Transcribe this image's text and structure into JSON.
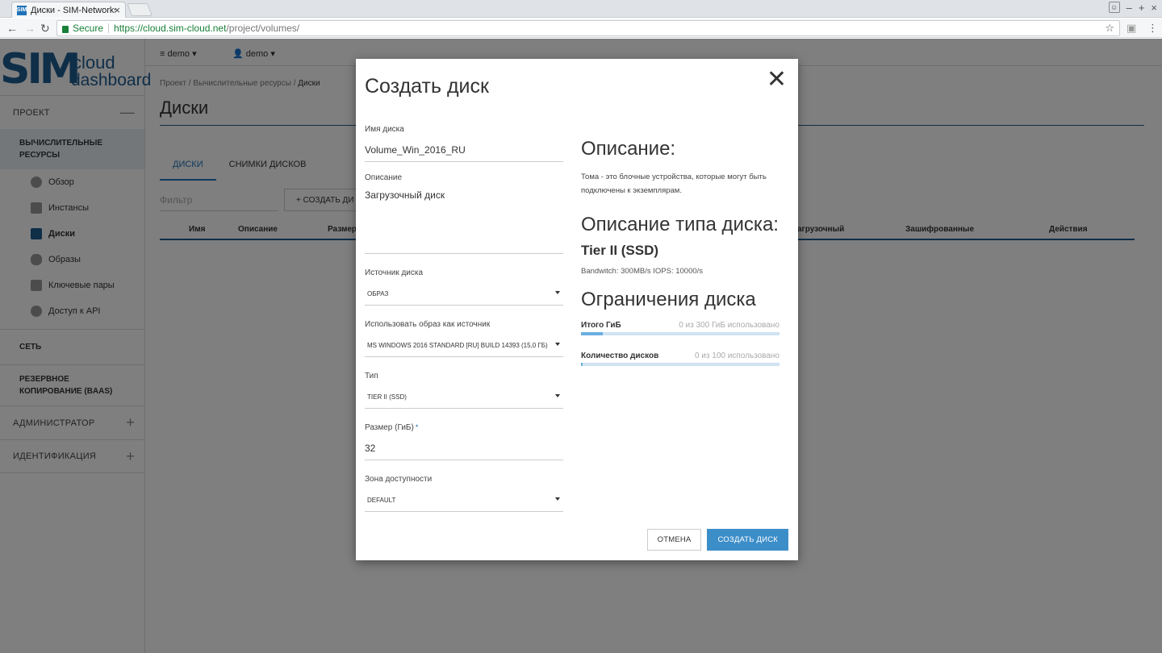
{
  "browser": {
    "tab_title": "Диски - SIM-Networks",
    "tab_favicon": "SIM",
    "secure_label": "Secure",
    "url_host": "https://cloud.sim-cloud.net",
    "url_path": "/project/volumes/"
  },
  "logo": {
    "sim": "SIM",
    "cloud": "cloud",
    "dashboard": "dashboard"
  },
  "topnav": {
    "project": "demo",
    "user": "demo"
  },
  "sidebar": {
    "project": "ПРОЕКТ",
    "compute": "ВЫЧИСЛИТЕЛЬНЫЕ РЕСУРСЫ",
    "items": [
      {
        "label": "Обзор"
      },
      {
        "label": "Инстансы"
      },
      {
        "label": "Диски"
      },
      {
        "label": "Образы"
      },
      {
        "label": "Ключевые пары"
      },
      {
        "label": "Доступ к API"
      }
    ],
    "network": "СЕТЬ",
    "backup": "РЕЗЕРВНОЕ КОПИРОВАНИЕ (BAAS)",
    "admin": "АДМИНИСТРАТОР",
    "identity": "ИДЕНТИФИКАЦИЯ"
  },
  "main": {
    "breadcrumb": [
      "Проект",
      "Вычислительные ресурсы",
      "Диски"
    ],
    "title": "Диски",
    "tabs": [
      "ДИСКИ",
      "СНИМКИ ДИСКОВ"
    ],
    "filter_placeholder": "Фильтр",
    "create_button": "+ СОЗДАТЬ ДИ",
    "columns": [
      "Имя",
      "Описание",
      "Размер",
      "агрузочный",
      "Зашифрованные",
      "Действия"
    ]
  },
  "modal": {
    "title": "Создать диск",
    "name_label": "Имя диска",
    "name_value": "Volume_Win_2016_RU",
    "desc_label": "Описание",
    "desc_value": "Загрузочный диск",
    "source_label": "Источник диска",
    "source_value": "ОБРАЗ",
    "image_label": "Использовать образ как источник",
    "image_value": "MS WINDOWS 2016 STANDARD [RU] BUILD 14393 (15,0 ГБ)",
    "type_label": "Тип",
    "type_value": "TIER II (SSD)",
    "size_label": "Размер (ГиБ)",
    "size_value": "32",
    "zone_label": "Зона доступности",
    "zone_value": "DEFAULT",
    "info_heading": "Описание:",
    "info_text": "Тома - это блочные устройства, которые могут быть подключены к экземплярам.",
    "type_heading": "Описание типа диска:",
    "type_name": "Tier II (SSD)",
    "type_spec": "Bandwitch: 300MB/s IOPS: 10000/s",
    "limits_heading": "Ограничения диска",
    "limit_total_label": "Итого ГиБ",
    "limit_total_usage": "0 из 300 ГиБ использовано",
    "limit_total_fraction": 0.11,
    "limit_count_label": "Количество дисков",
    "limit_count_usage": "0 из 100 использовано",
    "limit_count_fraction": 0.01,
    "cancel": "ОТМЕНА",
    "submit": "СОЗДАТЬ ДИСК"
  },
  "colors": {
    "brand": "#1f5d91",
    "primary_button": "#3c8ec9",
    "secure": "#188038"
  }
}
